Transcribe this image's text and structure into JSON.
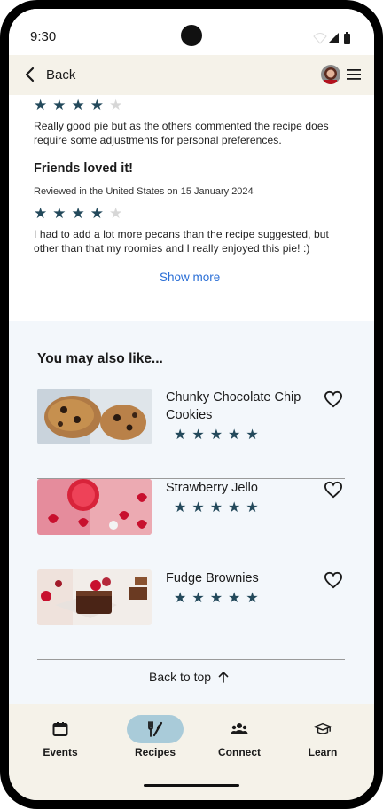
{
  "status_bar": {
    "time": "9:30"
  },
  "app_bar": {
    "back_label": "Back"
  },
  "reviews": [
    {
      "rating": 4,
      "text": "Really good pie but as the others commented the recipe does require some adjustments for personal preferences."
    },
    {
      "title": "Friends loved it!",
      "meta": "Reviewed in the United States on 15 January 2024",
      "rating": 4,
      "text": "I had to add a lot more pecans than the recipe suggested, but other than that my roomies and I really enjoyed this pie! :)"
    }
  ],
  "show_more_label": "Show more",
  "suggestions": {
    "heading": "You may also like...",
    "items": [
      {
        "title": "Chunky Chocolate Chip Cookies",
        "rating": 5,
        "image_icon": "cookies-photo"
      },
      {
        "title": "Strawberry Jello",
        "rating": 5,
        "image_icon": "jello-photo"
      },
      {
        "title": "Fudge Brownies",
        "rating": 5,
        "image_icon": "brownies-photo"
      }
    ],
    "back_to_top_label": "Back to top"
  },
  "bottom_nav": {
    "items": [
      {
        "label": "Events",
        "icon": "calendar-icon",
        "active": false
      },
      {
        "label": "Recipes",
        "icon": "utensils-icon",
        "active": true
      },
      {
        "label": "Connect",
        "icon": "people-icon",
        "active": false
      },
      {
        "label": "Learn",
        "icon": "graduation-cap-icon",
        "active": false
      }
    ]
  },
  "colors": {
    "star": "#23495b",
    "star_empty": "#d7d7d7",
    "link": "#2b6fd6",
    "nav_active": "#a9cbd9",
    "nav_bg": "#f5f2e9",
    "suggest_bg": "#f3f7fb"
  }
}
